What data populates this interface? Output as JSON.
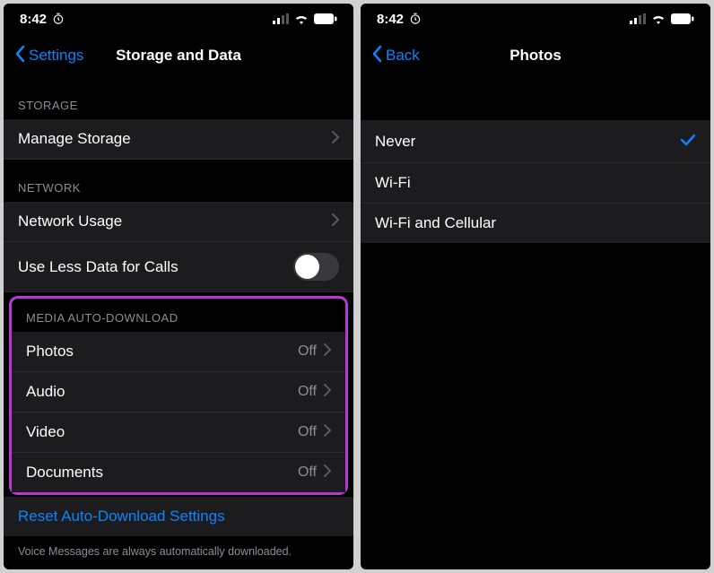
{
  "status": {
    "time": "8:42",
    "timer_icon": "⏱"
  },
  "screen1": {
    "back_label": "Settings",
    "title": "Storage and Data",
    "storage_header": "STORAGE",
    "manage_storage": "Manage Storage",
    "network_header": "NETWORK",
    "network_usage": "Network Usage",
    "less_data": "Use Less Data for Calls",
    "media_header": "MEDIA AUTO-DOWNLOAD",
    "media_items": [
      {
        "label": "Photos",
        "value": "Off"
      },
      {
        "label": "Audio",
        "value": "Off"
      },
      {
        "label": "Video",
        "value": "Off"
      },
      {
        "label": "Documents",
        "value": "Off"
      }
    ],
    "reset_label": "Reset Auto-Download Settings",
    "footer": "Voice Messages are always automatically downloaded."
  },
  "screen2": {
    "back_label": "Back",
    "title": "Photos",
    "options": [
      {
        "label": "Never",
        "selected": true
      },
      {
        "label": "Wi-Fi",
        "selected": false
      },
      {
        "label": "Wi-Fi and Cellular",
        "selected": false
      }
    ]
  }
}
